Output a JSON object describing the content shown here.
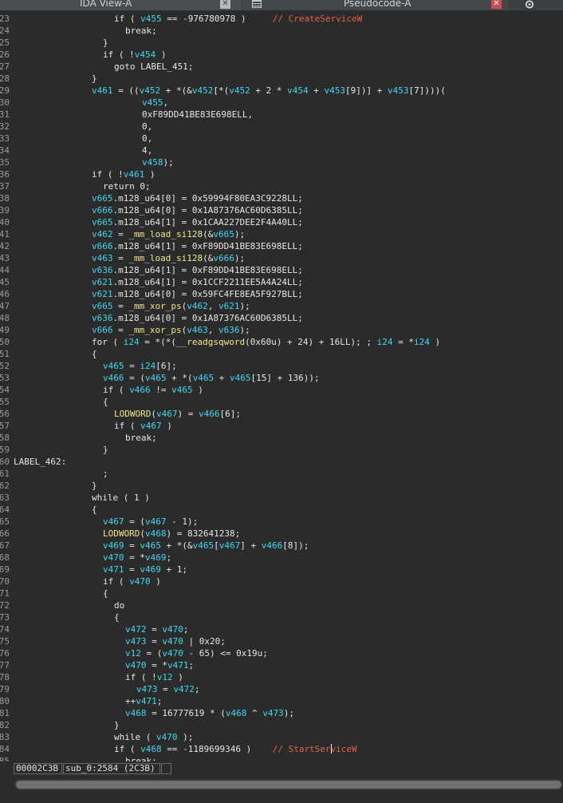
{
  "tabs": [
    {
      "label": "IDA View-A",
      "active": false
    },
    {
      "label": "Pseudocode-A",
      "active": true
    }
  ],
  "colors": {
    "plain": "#e6e6e6",
    "variable": "#41d7f0",
    "function": "#f0e68c",
    "comment": "#e8604c",
    "line_number": "#9a9a9a",
    "background": "#2b2b2b"
  },
  "icons": [
    "close-icon",
    "document-icon",
    "sync-icon"
  ],
  "code_lines": [
    {
      "ln": "23",
      "indent": 18,
      "tokens": [
        [
          "p",
          "if ( "
        ],
        [
          "v",
          "v455"
        ],
        [
          "p",
          " == -976780978 )     "
        ],
        [
          "c",
          "// CreateServiceW"
        ]
      ]
    },
    {
      "ln": "24",
      "indent": 20,
      "tokens": [
        [
          "p",
          "break;"
        ]
      ]
    },
    {
      "ln": "25",
      "indent": 16,
      "tokens": [
        [
          "p",
          "}"
        ]
      ]
    },
    {
      "ln": "26",
      "indent": 16,
      "tokens": [
        [
          "p",
          "if ( !"
        ],
        [
          "v",
          "v454"
        ],
        [
          "p",
          " )"
        ]
      ]
    },
    {
      "ln": "27",
      "indent": 18,
      "tokens": [
        [
          "p",
          "goto LABEL_451;"
        ]
      ]
    },
    {
      "ln": "28",
      "indent": 14,
      "tokens": [
        [
          "p",
          "}"
        ]
      ]
    },
    {
      "ln": "29",
      "indent": 14,
      "tokens": [
        [
          "v",
          "v461"
        ],
        [
          "p",
          " = (("
        ],
        [
          "v",
          "v452"
        ],
        [
          "p",
          " + *(&"
        ],
        [
          "v",
          "v452"
        ],
        [
          "p",
          "[*("
        ],
        [
          "v",
          "v452"
        ],
        [
          "p",
          " + 2 * "
        ],
        [
          "v",
          "v454"
        ],
        [
          "p",
          " + "
        ],
        [
          "v",
          "v453"
        ],
        [
          "p",
          "[9])] + "
        ],
        [
          "v",
          "v453"
        ],
        [
          "p",
          "[7])))("
        ]
      ]
    },
    {
      "ln": "30",
      "indent": 23,
      "tokens": [
        [
          "v",
          "v455"
        ],
        [
          "p",
          ","
        ]
      ]
    },
    {
      "ln": "31",
      "indent": 23,
      "tokens": [
        [
          "p",
          "0xF89DD41BE83E698ELL,"
        ]
      ]
    },
    {
      "ln": "32",
      "indent": 23,
      "tokens": [
        [
          "p",
          "0,"
        ]
      ]
    },
    {
      "ln": "33",
      "indent": 23,
      "tokens": [
        [
          "p",
          "0,"
        ]
      ]
    },
    {
      "ln": "34",
      "indent": 23,
      "tokens": [
        [
          "p",
          "4,"
        ]
      ]
    },
    {
      "ln": "35",
      "indent": 23,
      "tokens": [
        [
          "v",
          "v458"
        ],
        [
          "p",
          ");"
        ]
      ]
    },
    {
      "ln": "36",
      "indent": 14,
      "tokens": [
        [
          "p",
          "if ( !"
        ],
        [
          "v",
          "v461"
        ],
        [
          "p",
          " )"
        ]
      ]
    },
    {
      "ln": "37",
      "indent": 16,
      "tokens": [
        [
          "p",
          "return 0;"
        ]
      ]
    },
    {
      "ln": "38",
      "indent": 14,
      "tokens": [
        [
          "v",
          "v665"
        ],
        [
          "p",
          ".m128_u64[0] = 0x59994F80EA3C9228LL;"
        ]
      ]
    },
    {
      "ln": "39",
      "indent": 14,
      "tokens": [
        [
          "v",
          "v666"
        ],
        [
          "p",
          ".m128_u64[0] = 0x1A87376AC60D6385LL;"
        ]
      ]
    },
    {
      "ln": "40",
      "indent": 14,
      "tokens": [
        [
          "v",
          "v665"
        ],
        [
          "p",
          ".m128_u64[1] = 0x1CAA227DEE2F4A40LL;"
        ]
      ]
    },
    {
      "ln": "41",
      "indent": 14,
      "tokens": [
        [
          "v",
          "v462"
        ],
        [
          "p",
          " = "
        ],
        [
          "f",
          "_mm_load_si128"
        ],
        [
          "p",
          "(&"
        ],
        [
          "v",
          "v665"
        ],
        [
          "p",
          ");"
        ]
      ]
    },
    {
      "ln": "42",
      "indent": 14,
      "tokens": [
        [
          "v",
          "v666"
        ],
        [
          "p",
          ".m128_u64[1] = 0xF89DD41BE83E698ELL;"
        ]
      ]
    },
    {
      "ln": "43",
      "indent": 14,
      "tokens": [
        [
          "v",
          "v463"
        ],
        [
          "p",
          " = "
        ],
        [
          "f",
          "_mm_load_si128"
        ],
        [
          "p",
          "(&"
        ],
        [
          "v",
          "v666"
        ],
        [
          "p",
          ");"
        ]
      ]
    },
    {
      "ln": "44",
      "indent": 14,
      "tokens": [
        [
          "v",
          "v636"
        ],
        [
          "p",
          ".m128_u64[1] = 0xF89DD41BE83E698ELL;"
        ]
      ]
    },
    {
      "ln": "45",
      "indent": 14,
      "tokens": [
        [
          "v",
          "v621"
        ],
        [
          "p",
          ".m128_u64[1] = 0x1CCF2211EE5A4A24LL;"
        ]
      ]
    },
    {
      "ln": "46",
      "indent": 14,
      "tokens": [
        [
          "v",
          "v621"
        ],
        [
          "p",
          ".m128_u64[0] = 0x59FC4FE8EA5F927BLL;"
        ]
      ]
    },
    {
      "ln": "47",
      "indent": 14,
      "tokens": [
        [
          "v",
          "v665"
        ],
        [
          "p",
          " = "
        ],
        [
          "f",
          "_mm_xor_ps"
        ],
        [
          "p",
          "("
        ],
        [
          "v",
          "v462"
        ],
        [
          "p",
          ", "
        ],
        [
          "v",
          "v621"
        ],
        [
          "p",
          ");"
        ]
      ]
    },
    {
      "ln": "48",
      "indent": 14,
      "tokens": [
        [
          "v",
          "v636"
        ],
        [
          "p",
          ".m128_u64[0] = 0x1A87376AC60D6385LL;"
        ]
      ]
    },
    {
      "ln": "49",
      "indent": 14,
      "tokens": [
        [
          "v",
          "v666"
        ],
        [
          "p",
          " = "
        ],
        [
          "f",
          "_mm_xor_ps"
        ],
        [
          "p",
          "("
        ],
        [
          "v",
          "v463"
        ],
        [
          "p",
          ", "
        ],
        [
          "v",
          "v636"
        ],
        [
          "p",
          ");"
        ]
      ]
    },
    {
      "ln": "50",
      "indent": 14,
      "tokens": [
        [
          "p",
          "for ( "
        ],
        [
          "v",
          "i24"
        ],
        [
          "p",
          " = *(*("
        ],
        [
          "f",
          "__readgsqword"
        ],
        [
          "p",
          "(0x60u) + 24) + 16LL); ; "
        ],
        [
          "v",
          "i24"
        ],
        [
          "p",
          " = *"
        ],
        [
          "v",
          "i24"
        ],
        [
          "p",
          " )"
        ]
      ]
    },
    {
      "ln": "51",
      "indent": 14,
      "tokens": [
        [
          "p",
          "{"
        ]
      ]
    },
    {
      "ln": "52",
      "indent": 16,
      "tokens": [
        [
          "v",
          "v465"
        ],
        [
          "p",
          " = "
        ],
        [
          "v",
          "i24"
        ],
        [
          "p",
          "[6];"
        ]
      ]
    },
    {
      "ln": "53",
      "indent": 16,
      "tokens": [
        [
          "v",
          "v466"
        ],
        [
          "p",
          " = ("
        ],
        [
          "v",
          "v465"
        ],
        [
          "p",
          " + *("
        ],
        [
          "v",
          "v465"
        ],
        [
          "p",
          " + "
        ],
        [
          "v",
          "v465"
        ],
        [
          "p",
          "[15] + 136));"
        ]
      ]
    },
    {
      "ln": "54",
      "indent": 16,
      "tokens": [
        [
          "p",
          "if ( "
        ],
        [
          "v",
          "v466"
        ],
        [
          "p",
          " != "
        ],
        [
          "v",
          "v465"
        ],
        [
          "p",
          " )"
        ]
      ]
    },
    {
      "ln": "55",
      "indent": 16,
      "tokens": [
        [
          "p",
          "{"
        ]
      ]
    },
    {
      "ln": "56",
      "indent": 18,
      "tokens": [
        [
          "f",
          "LODWORD"
        ],
        [
          "p",
          "("
        ],
        [
          "v",
          "v467"
        ],
        [
          "p",
          ") = "
        ],
        [
          "v",
          "v466"
        ],
        [
          "p",
          "[6];"
        ]
      ]
    },
    {
      "ln": "57",
      "indent": 18,
      "tokens": [
        [
          "p",
          "if ( "
        ],
        [
          "v",
          "v467"
        ],
        [
          "p",
          " )"
        ]
      ]
    },
    {
      "ln": "58",
      "indent": 20,
      "tokens": [
        [
          "p",
          "break;"
        ]
      ]
    },
    {
      "ln": "59",
      "indent": 16,
      "tokens": [
        [
          "p",
          "}"
        ]
      ]
    },
    {
      "ln": "60",
      "indent": 0,
      "tokens": [
        [
          "p",
          "LABEL_462:"
        ]
      ]
    },
    {
      "ln": "61",
      "indent": 16,
      "tokens": [
        [
          "p",
          ";"
        ]
      ]
    },
    {
      "ln": "62",
      "indent": 14,
      "tokens": [
        [
          "p",
          "}"
        ]
      ]
    },
    {
      "ln": "63",
      "indent": 14,
      "tokens": [
        [
          "p",
          "while ( 1 )"
        ]
      ]
    },
    {
      "ln": "64",
      "indent": 14,
      "tokens": [
        [
          "p",
          "{"
        ]
      ]
    },
    {
      "ln": "65",
      "indent": 16,
      "tokens": [
        [
          "v",
          "v467"
        ],
        [
          "p",
          " = ("
        ],
        [
          "v",
          "v467"
        ],
        [
          "p",
          " - 1);"
        ]
      ]
    },
    {
      "ln": "66",
      "indent": 16,
      "tokens": [
        [
          "f",
          "LODWORD"
        ],
        [
          "p",
          "("
        ],
        [
          "v",
          "v468"
        ],
        [
          "p",
          ") = 832641238;"
        ]
      ]
    },
    {
      "ln": "67",
      "indent": 16,
      "tokens": [
        [
          "v",
          "v469"
        ],
        [
          "p",
          " = "
        ],
        [
          "v",
          "v465"
        ],
        [
          "p",
          " + *(&"
        ],
        [
          "v",
          "v465"
        ],
        [
          "p",
          "["
        ],
        [
          "v",
          "v467"
        ],
        [
          "p",
          "] + "
        ],
        [
          "v",
          "v466"
        ],
        [
          "p",
          "[8]);"
        ]
      ]
    },
    {
      "ln": "68",
      "indent": 16,
      "tokens": [
        [
          "v",
          "v470"
        ],
        [
          "p",
          " = *"
        ],
        [
          "v",
          "v469"
        ],
        [
          "p",
          ";"
        ]
      ]
    },
    {
      "ln": "69",
      "indent": 16,
      "tokens": [
        [
          "v",
          "v471"
        ],
        [
          "p",
          " = "
        ],
        [
          "v",
          "v469"
        ],
        [
          "p",
          " + 1;"
        ]
      ]
    },
    {
      "ln": "70",
      "indent": 16,
      "tokens": [
        [
          "p",
          "if ( "
        ],
        [
          "v",
          "v470"
        ],
        [
          "p",
          " )"
        ]
      ]
    },
    {
      "ln": "71",
      "indent": 16,
      "tokens": [
        [
          "p",
          "{"
        ]
      ]
    },
    {
      "ln": "72",
      "indent": 18,
      "tokens": [
        [
          "p",
          "do"
        ]
      ]
    },
    {
      "ln": "73",
      "indent": 18,
      "tokens": [
        [
          "p",
          "{"
        ]
      ]
    },
    {
      "ln": "74",
      "indent": 20,
      "tokens": [
        [
          "v",
          "v472"
        ],
        [
          "p",
          " = "
        ],
        [
          "v",
          "v470"
        ],
        [
          "p",
          ";"
        ]
      ]
    },
    {
      "ln": "75",
      "indent": 20,
      "tokens": [
        [
          "v",
          "v473"
        ],
        [
          "p",
          " = "
        ],
        [
          "v",
          "v470"
        ],
        [
          "p",
          " | 0x20;"
        ]
      ]
    },
    {
      "ln": "76",
      "indent": 20,
      "tokens": [
        [
          "v",
          "v12"
        ],
        [
          "p",
          " = ("
        ],
        [
          "v",
          "v470"
        ],
        [
          "p",
          " - 65) <= 0x19u;"
        ]
      ]
    },
    {
      "ln": "77",
      "indent": 20,
      "tokens": [
        [
          "v",
          "v470"
        ],
        [
          "p",
          " = *"
        ],
        [
          "v",
          "v471"
        ],
        [
          "p",
          ";"
        ]
      ]
    },
    {
      "ln": "78",
      "indent": 20,
      "tokens": [
        [
          "p",
          "if ( !"
        ],
        [
          "v",
          "v12"
        ],
        [
          "p",
          " )"
        ]
      ]
    },
    {
      "ln": "79",
      "indent": 22,
      "tokens": [
        [
          "v",
          "v473"
        ],
        [
          "p",
          " = "
        ],
        [
          "v",
          "v472"
        ],
        [
          "p",
          ";"
        ]
      ]
    },
    {
      "ln": "80",
      "indent": 20,
      "tokens": [
        [
          "p",
          "++"
        ],
        [
          "v",
          "v471"
        ],
        [
          "p",
          ";"
        ]
      ]
    },
    {
      "ln": "81",
      "indent": 20,
      "tokens": [
        [
          "v",
          "v468"
        ],
        [
          "p",
          " = 16777619 * ("
        ],
        [
          "v",
          "v468"
        ],
        [
          "p",
          " ^ "
        ],
        [
          "v",
          "v473"
        ],
        [
          "p",
          ");"
        ]
      ]
    },
    {
      "ln": "82",
      "indent": 18,
      "tokens": [
        [
          "p",
          "}"
        ]
      ]
    },
    {
      "ln": "83",
      "indent": 18,
      "tokens": [
        [
          "p",
          "while ( "
        ],
        [
          "v",
          "v470"
        ],
        [
          "p",
          " );"
        ]
      ]
    },
    {
      "ln": "84",
      "indent": 18,
      "tokens": [
        [
          "p",
          "if ( "
        ],
        [
          "v",
          "v468"
        ],
        [
          "p",
          " == -1189699346 )    "
        ],
        [
          "c",
          "// StartSer"
        ],
        [
          "caret",
          ""
        ],
        [
          "c",
          "viceW"
        ]
      ]
    },
    {
      "ln": "85",
      "indent": 20,
      "tokens": [
        [
          "p",
          "break;"
        ]
      ]
    }
  ],
  "status": {
    "address": "00002C3B",
    "function": "sub_0:2584 (2C3B)",
    "extra": ""
  }
}
